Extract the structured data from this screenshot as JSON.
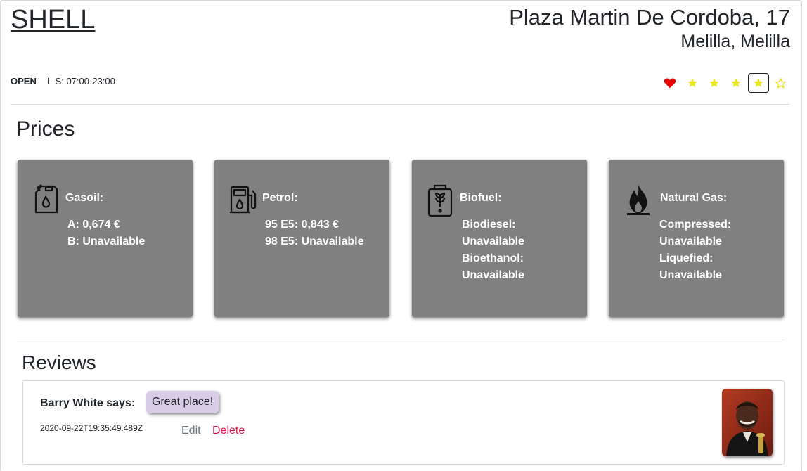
{
  "station": {
    "brand": "SHELL",
    "address_line1": "Plaza Martin De Cordoba, 17",
    "address_line2": "Melilla, Melilla",
    "status": "OPEN",
    "hours": "L-S: 07:00-23:00"
  },
  "rating_icons": {
    "favorite": "heart-icon",
    "stars_filled": 4,
    "stars_total": 5,
    "selected_star": 4,
    "colors": {
      "heart": "#ee0000",
      "star": "#e8e81a"
    }
  },
  "prices": {
    "title": "Prices",
    "cards": [
      {
        "icon": "jerrycan-icon",
        "title": "Gasoil:",
        "lines": [
          "A: 0,674 €",
          "B: Unavailable"
        ]
      },
      {
        "icon": "fuel-pump-icon",
        "title": "Petrol:",
        "lines": [
          "95 E5: 0,843 €",
          "98 E5: Unavailable"
        ]
      },
      {
        "icon": "biofuel-can-icon",
        "title": "Biofuel:",
        "lines": [
          "Biodiesel:",
          "Unavailable",
          "Bioethanol:",
          "Unavailable"
        ]
      },
      {
        "icon": "flame-icon",
        "title": "Natural Gas:",
        "lines": [
          "Compressed:",
          "Unavailable",
          "Liquefied:",
          "Unavailable"
        ]
      }
    ],
    "card_color": "#808080"
  },
  "reviews": {
    "title": "Reviews",
    "items": [
      {
        "author": "Barry White says:",
        "text": "Great place!",
        "date": "2020-09-22T19:35:49.489Z",
        "edit_label": "Edit",
        "delete_label": "Delete"
      }
    ]
  }
}
